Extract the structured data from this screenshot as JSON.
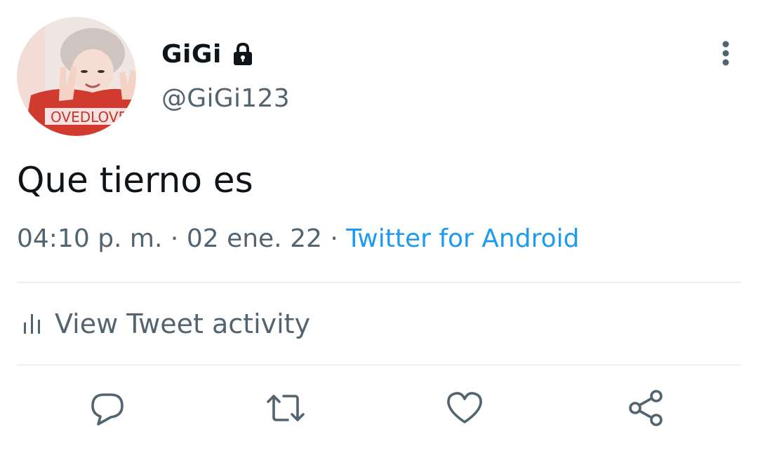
{
  "author": {
    "display_name": "GiGi",
    "handle": "@GiGi123",
    "avatar_name": "avatar",
    "avatar_shirt_text": "OVEDLOVE",
    "protected_icon": "lock-icon"
  },
  "tweet": {
    "text": "Que tierno es",
    "time": "04:10 p. m.",
    "separator": "·",
    "date": "02 ene. 22",
    "source": "Twitter for Android"
  },
  "activity": {
    "icon": "bar-chart-icon",
    "label": "View Tweet activity"
  },
  "actions": [
    {
      "name": "reply",
      "icon": "speech-bubble-icon"
    },
    {
      "name": "retweet",
      "icon": "retweet-arrows-icon"
    },
    {
      "name": "like",
      "icon": "heart-icon"
    },
    {
      "name": "share",
      "icon": "share-icon"
    }
  ],
  "menu": {
    "icon": "vertical-ellipsis-icon"
  },
  "colors": {
    "text_primary": "#0f1419",
    "text_secondary": "#536471",
    "link": "#1d9bf0",
    "divider": "#e2e5e8",
    "icon": "#536471"
  }
}
